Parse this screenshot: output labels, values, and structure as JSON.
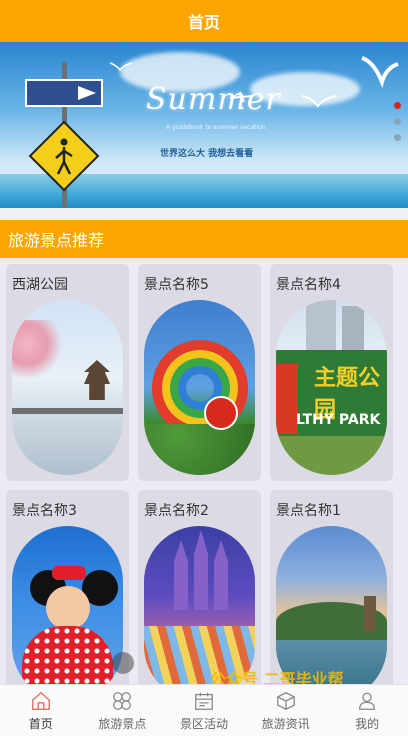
{
  "header": {
    "title": "首页"
  },
  "banner": {
    "headline": "Summer",
    "subline": "A guidebook to summer vacation",
    "caption": "世界这么大  我想去看看",
    "slides": 3,
    "active_slide": 1
  },
  "section": {
    "title": "旅游景点推荐"
  },
  "attractions": [
    {
      "name": "西湖公园"
    },
    {
      "name": "景点名称5"
    },
    {
      "name": "景点名称4",
      "sign_cn": "主题公园",
      "sign_en": "LTHY PARK"
    },
    {
      "name": "景点名称3"
    },
    {
      "name": "景点名称2"
    },
    {
      "name": "景点名称1"
    }
  ],
  "watermark": "公众号  二哥毕业帮",
  "tabbar": [
    {
      "label": "首页",
      "icon": "home-icon",
      "active": true
    },
    {
      "label": "旅游景点",
      "icon": "grid-clover-icon",
      "active": false
    },
    {
      "label": "景区活动",
      "icon": "calendar-icon",
      "active": false
    },
    {
      "label": "旅游资讯",
      "icon": "box-icon",
      "active": false
    },
    {
      "label": "我的",
      "icon": "user-icon",
      "active": false
    }
  ],
  "colors": {
    "accent": "#fba500",
    "active_dot": "#e02020",
    "home_icon": "#e8786d"
  }
}
